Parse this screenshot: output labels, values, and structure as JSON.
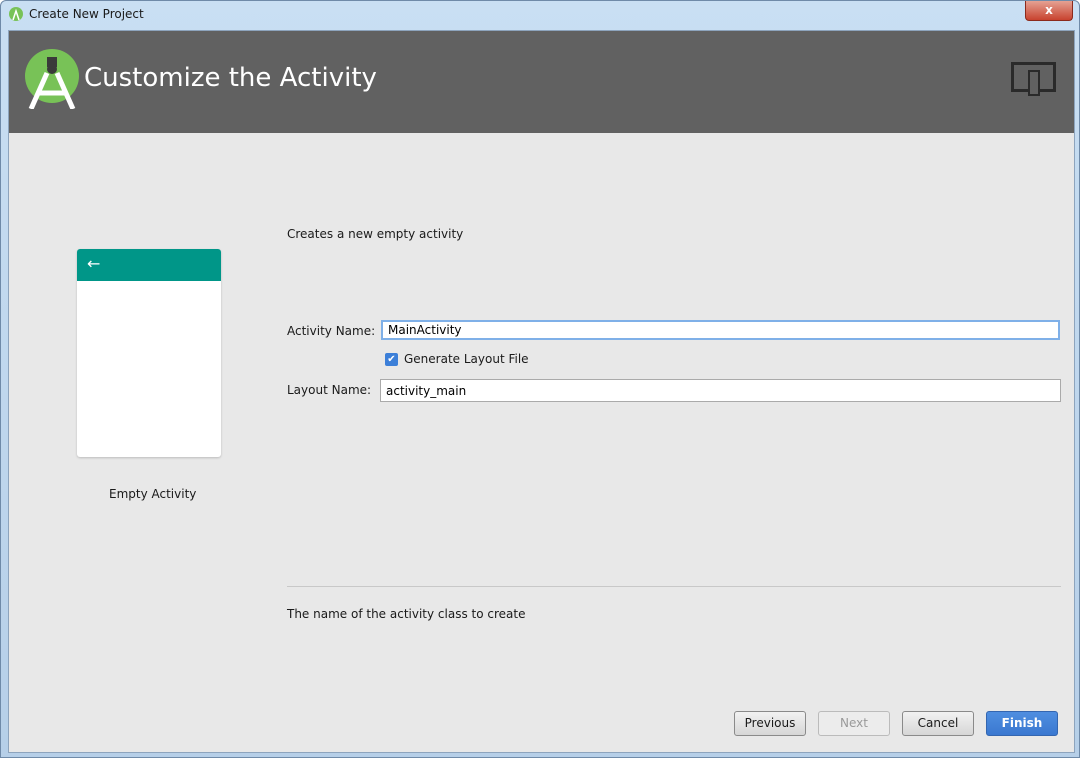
{
  "window": {
    "title": "Create New Project",
    "close": "x"
  },
  "header": {
    "title": "Customize the Activity",
    "logo": "android-studio-logo",
    "device_icon": "device-icon"
  },
  "template": {
    "name": "Empty Activity",
    "back_icon": "←",
    "accent": "#009688"
  },
  "form": {
    "description": "Creates a new empty activity",
    "activity_name_label": "Activity Name:",
    "activity_name_value": "MainActivity",
    "generate_layout_label": "Generate Layout File",
    "generate_layout_checked": true,
    "layout_name_label": "Layout Name:",
    "layout_name_value": "activity_main",
    "hint": "The name of the activity class to create"
  },
  "buttons": {
    "previous": "Previous",
    "next": "Next",
    "cancel": "Cancel",
    "finish": "Finish"
  }
}
